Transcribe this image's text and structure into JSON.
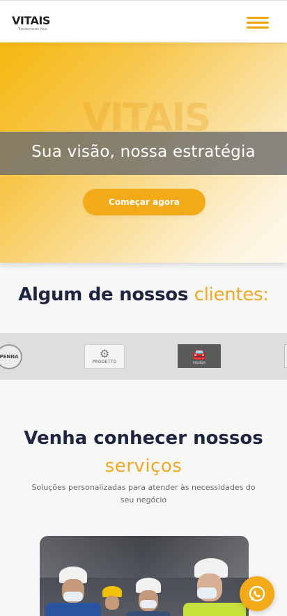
{
  "header": {
    "logo_text": "VITAIS",
    "logo_tagline": "Transformando Vidas",
    "menu_icon": "hamburger-icon"
  },
  "hero": {
    "watermark": "VITAIS",
    "title": "Sua visão, nossa estratégia",
    "cta_label": "Começar agora"
  },
  "clients": {
    "title_main": "Algum de nossos ",
    "title_highlight": "clientes:",
    "logos": [
      {
        "name": "PENNA"
      },
      {
        "name": "PROGETTO"
      },
      {
        "name": "RIQUEZA"
      }
    ]
  },
  "services": {
    "title_line1": "Venha conhecer nossos",
    "title_line2": "serviços",
    "subtitle": "Soluções personalizadas para atender às necessidades do seu negócio"
  },
  "whatsapp": {
    "icon": "whatsapp-icon"
  },
  "colors": {
    "accent": "#f3aa18",
    "navy": "#1d2540"
  }
}
